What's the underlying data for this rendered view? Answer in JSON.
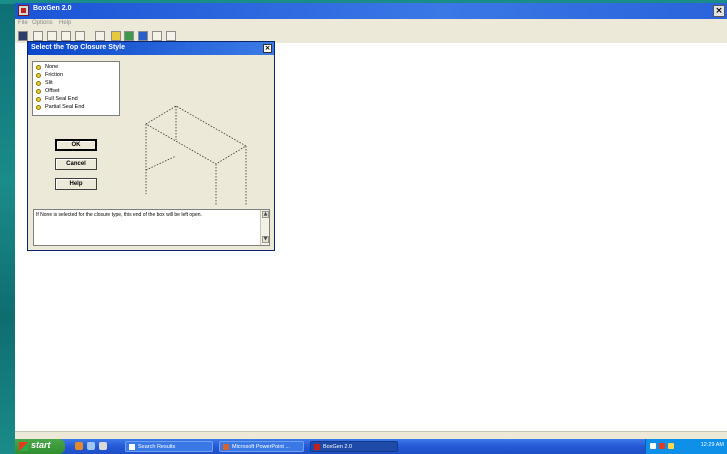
{
  "app": {
    "title": "BoxGen 2.0",
    "close_glyph": "×",
    "menu": [
      "File",
      "Options",
      "Help"
    ]
  },
  "dialog": {
    "title": "Select the Top Closure Style",
    "close_glyph": "×",
    "options": [
      "None",
      "Friction",
      "Slit",
      "Offset",
      "Full Seal End",
      "Partial Seal End"
    ],
    "selected": "None",
    "buttons": {
      "ok": "OK",
      "cancel": "Cancel",
      "help": "Help"
    },
    "description": "If None is selected for the closure type, this end of the box will be left open.",
    "scroll_up": "▲",
    "scroll_down": "▼"
  },
  "taskbar": {
    "start_label": "start",
    "tasks": [
      {
        "label": "Search Results",
        "icon": "search-results-icon"
      },
      {
        "label": "Microsoft PowerPoint ...",
        "icon": "powerpoint-icon"
      },
      {
        "label": "BoxGen 2.0",
        "icon": "boxgen-icon"
      }
    ],
    "clock": "12:29 AM"
  },
  "icons": {
    "app": "boxgen-app-icon",
    "toolbar": [
      "open-icon",
      "new-icon",
      "copy-icon",
      "paste-icon",
      "cut-icon",
      "box-icon",
      "paint-icon",
      "globe-icon",
      "help-icon",
      "zoom-icon"
    ]
  },
  "colors": {
    "titlebar": "#1c54d6",
    "dialog_bg": "#ece9d8",
    "taskbar": "#2558d6",
    "option_dot": "#e8d51f",
    "start_button": "#2f8f2f"
  }
}
